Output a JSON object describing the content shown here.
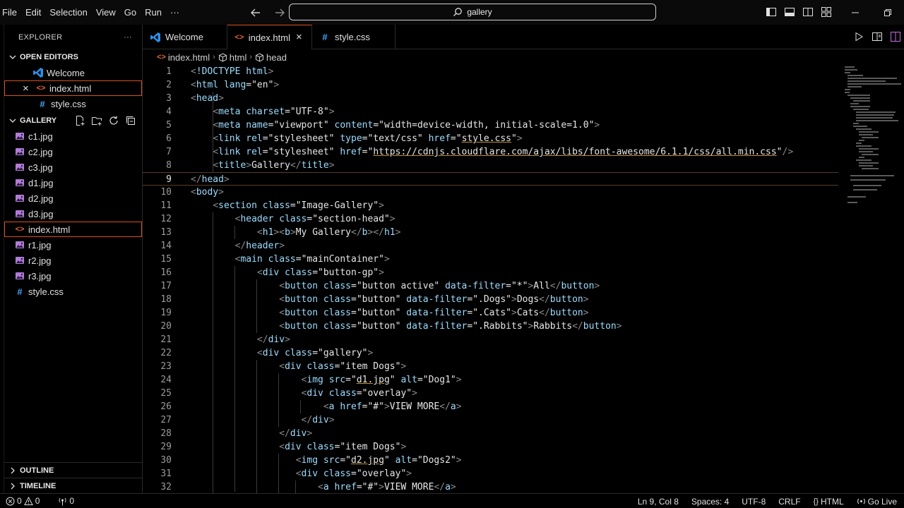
{
  "menu": [
    "File",
    "Edit",
    "Selection",
    "View",
    "Go",
    "Run",
    "···"
  ],
  "command_center": {
    "text": "gallery"
  },
  "explorer": {
    "title": "EXPLORER",
    "more": "···",
    "open_editors": {
      "label": "OPEN EDITORS",
      "items": [
        {
          "name": "Welcome",
          "icon": "vscode-icon"
        },
        {
          "name": "index.html",
          "icon": "html-icon",
          "close": "×"
        },
        {
          "name": "style.css",
          "icon": "css-icon"
        }
      ]
    },
    "gallery": {
      "label": "GALLERY",
      "files": [
        {
          "name": "c1.jpg",
          "type": "image"
        },
        {
          "name": "c2.jpg",
          "type": "image"
        },
        {
          "name": "c3.jpg",
          "type": "image"
        },
        {
          "name": "d1.jpg",
          "type": "image"
        },
        {
          "name": "d2.jpg",
          "type": "image"
        },
        {
          "name": "d3.jpg",
          "type": "image"
        },
        {
          "name": "index.html",
          "type": "html"
        },
        {
          "name": "r1.jpg",
          "type": "image"
        },
        {
          "name": "r2.jpg",
          "type": "image"
        },
        {
          "name": "r3.jpg",
          "type": "image"
        },
        {
          "name": "style.css",
          "type": "css"
        }
      ]
    },
    "outline": "OUTLINE",
    "timeline": "TIMELINE"
  },
  "tabs": [
    {
      "label": "Welcome",
      "icon": "vscode-icon"
    },
    {
      "label": "index.html",
      "icon": "html-icon",
      "active": true,
      "close": "×"
    },
    {
      "label": "style.css",
      "icon": "css-icon"
    }
  ],
  "breadcrumb": [
    "index.html",
    "html",
    "head"
  ],
  "editor": {
    "lines": [
      "<!DOCTYPE html>",
      "<html lang=\"en\">",
      "<head>",
      "    <meta charset=\"UTF-8\">",
      "    <meta name=\"viewport\" content=\"width=device-width, initial-scale=1.0\">",
      "    <link rel=\"stylesheet\" type=\"text/css\" href=\"style.css\">",
      "    <link rel=\"stylesheet\" href=\"https://cdnjs.cloudflare.com/ajax/libs/font-awesome/6.1.1/css/all.min.css\"/>",
      "    <title>Gallery</title>",
      "</head>",
      "<body>",
      "    <section class=\"Image-Gallery\">",
      "        <header class=\"section-head\">",
      "            <h1><b>My Gallery</b></h1>",
      "        </header>",
      "        <main class=\"mainContainer\">",
      "            <div class=\"button-gp\">",
      "                <button class=\"button active\" data-filter=\"*\">All</button>",
      "                <button class=\"button\" data-filter=\".Dogs\">Dogs</button>",
      "                <button class=\"button\" data-filter=\".Cats\">Cats</button>",
      "                <button class=\"button\" data-filter=\".Rabbits\">Rabbits</button>",
      "            </div>",
      "            <div class=\"gallery\">",
      "                <div class=\"item Dogs\">",
      "                    <img src=\"d1.jpg\" alt=\"Dog1\">",
      "                    <div class=\"overlay\">",
      "                        <a href=\"#\">VIEW MORE</a>",
      "                    </div>",
      "                </div>",
      "                <div class=\"item Dogs\">",
      "                   <img src=\"d2.jpg\" alt=\"Dogs2\">",
      "                   <div class=\"overlay\">",
      "                       <a href=\"#\">VIEW MORE</a>"
    ],
    "current_line": 9
  },
  "status": {
    "errors": "0",
    "warnings": "0",
    "ports": "0",
    "position": "Ln 9, Col 8",
    "spaces": "Spaces: 4",
    "encoding": "UTF-8",
    "eol": "CRLF",
    "language": "HTML",
    "golive": "Go Live"
  },
  "colors": {
    "accent": "#d8501f",
    "vscode_blue": "#2f8fe8",
    "css_blue": "#42a5f5",
    "html_orange": "#e8643a",
    "image_purple": "#b07cd8"
  }
}
